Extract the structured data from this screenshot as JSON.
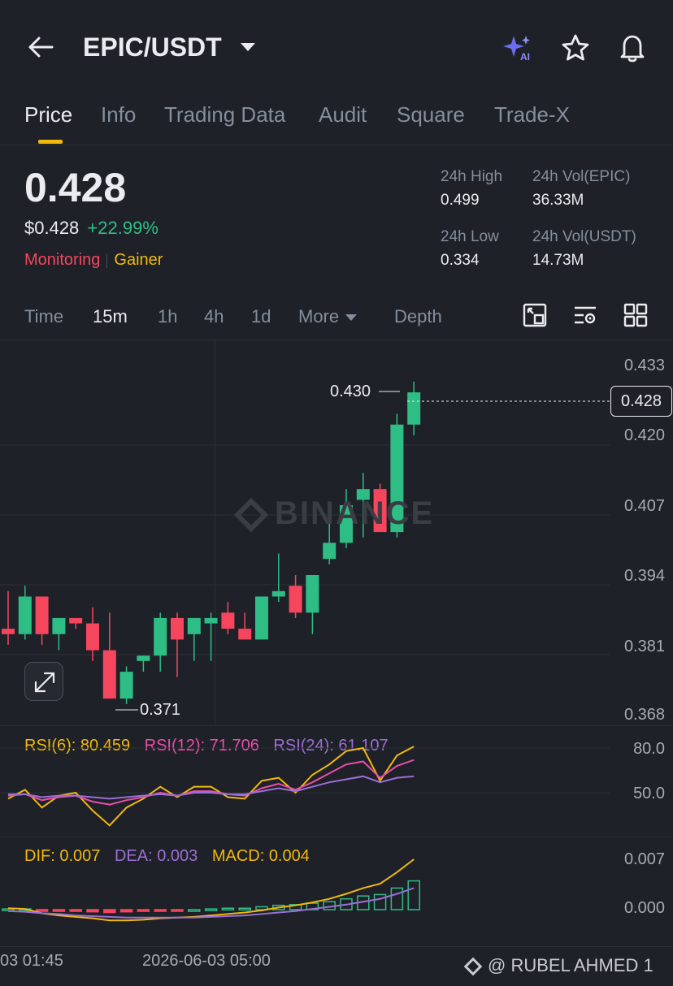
{
  "header": {
    "pair": "EPIC/USDT"
  },
  "tabs": [
    "Price",
    "Info",
    "Trading Data",
    "Audit",
    "Square",
    "Trade-X"
  ],
  "price": {
    "last": "0.428",
    "usd": "$0.428",
    "change": "+22.99%",
    "tag_monitoring": "Monitoring",
    "tag_gainer": "Gainer"
  },
  "stats": {
    "high_label": "24h High",
    "high_value": "0.499",
    "vol_base_label": "24h Vol(EPIC)",
    "vol_base_value": "36.33M",
    "low_label": "24h Low",
    "low_value": "0.334",
    "vol_quote_label": "24h Vol(USDT)",
    "vol_quote_value": "14.73M"
  },
  "toolbar": {
    "time": "Time",
    "m15": "15m",
    "h1": "1h",
    "h4": "4h",
    "d1": "1d",
    "more": "More",
    "depth": "Depth"
  },
  "chart": {
    "y_ticks": [
      "0.433",
      "0.420",
      "0.407",
      "0.394",
      "0.381",
      "0.368"
    ],
    "current_price": "0.428",
    "high_marker": "0.430",
    "low_marker": "0.371",
    "watermark": "BINANCE"
  },
  "rsi": {
    "rsi6": "RSI(6): 80.459",
    "rsi12": "RSI(12): 71.706",
    "rsi24": "RSI(24): 61.107",
    "y_ticks": [
      "80.0",
      "50.0"
    ]
  },
  "macd": {
    "dif": "DIF: 0.007",
    "dea": "DEA: 0.003",
    "macd": "MACD: 0.004",
    "y_ticks": [
      "0.007",
      "0.000"
    ]
  },
  "x_axis": {
    "label1": "03 01:45",
    "label2": "2026-06-03 05:00"
  },
  "credit": "@ RUBEL AHMED 1",
  "colors": {
    "up": "#2ebd85",
    "down": "#f6465d",
    "accent": "#f0b90b",
    "rsi6": "#f0b90b",
    "rsi12": "#e84fa8",
    "rsi24": "#9b6fd6"
  },
  "chart_data": {
    "type": "candlestick",
    "interval": "15m",
    "ylim": [
      0.368,
      0.433
    ],
    "candles": [
      {
        "o": 0.384,
        "h": 0.391,
        "l": 0.381,
        "c": 0.383
      },
      {
        "o": 0.383,
        "h": 0.392,
        "l": 0.382,
        "c": 0.39
      },
      {
        "o": 0.39,
        "h": 0.39,
        "l": 0.381,
        "c": 0.383
      },
      {
        "o": 0.383,
        "h": 0.386,
        "l": 0.38,
        "c": 0.386
      },
      {
        "o": 0.386,
        "h": 0.386,
        "l": 0.384,
        "c": 0.385
      },
      {
        "o": 0.385,
        "h": 0.388,
        "l": 0.378,
        "c": 0.38
      },
      {
        "o": 0.38,
        "h": 0.387,
        "l": 0.371,
        "c": 0.371
      },
      {
        "o": 0.371,
        "h": 0.377,
        "l": 0.37,
        "c": 0.376
      },
      {
        "o": 0.378,
        "h": 0.379,
        "l": 0.376,
        "c": 0.379
      },
      {
        "o": 0.379,
        "h": 0.387,
        "l": 0.376,
        "c": 0.386
      },
      {
        "o": 0.386,
        "h": 0.387,
        "l": 0.375,
        "c": 0.382
      },
      {
        "o": 0.383,
        "h": 0.386,
        "l": 0.378,
        "c": 0.386
      },
      {
        "o": 0.385,
        "h": 0.387,
        "l": 0.378,
        "c": 0.386
      },
      {
        "o": 0.387,
        "h": 0.389,
        "l": 0.383,
        "c": 0.384
      },
      {
        "o": 0.384,
        "h": 0.387,
        "l": 0.382,
        "c": 0.382
      },
      {
        "o": 0.382,
        "h": 0.39,
        "l": 0.382,
        "c": 0.39
      },
      {
        "o": 0.39,
        "h": 0.398,
        "l": 0.389,
        "c": 0.391
      },
      {
        "o": 0.392,
        "h": 0.394,
        "l": 0.386,
        "c": 0.387
      },
      {
        "o": 0.387,
        "h": 0.394,
        "l": 0.383,
        "c": 0.394
      },
      {
        "o": 0.397,
        "h": 0.404,
        "l": 0.396,
        "c": 0.4
      },
      {
        "o": 0.4,
        "h": 0.41,
        "l": 0.399,
        "c": 0.407
      },
      {
        "o": 0.408,
        "h": 0.413,
        "l": 0.401,
        "c": 0.41
      },
      {
        "o": 0.41,
        "h": 0.411,
        "l": 0.402,
        "c": 0.402
      },
      {
        "o": 0.402,
        "h": 0.424,
        "l": 0.401,
        "c": 0.422
      },
      {
        "o": 0.422,
        "h": 0.43,
        "l": 0.42,
        "c": 0.428
      }
    ],
    "rsi6": [
      46,
      52,
      40,
      48,
      50,
      38,
      28,
      40,
      46,
      54,
      47,
      54,
      54,
      47,
      46,
      58,
      60,
      50,
      62,
      69,
      78,
      80,
      58,
      75,
      81
    ],
    "rsi12": [
      48,
      49,
      45,
      47,
      48,
      44,
      42,
      45,
      47,
      50,
      48,
      51,
      51,
      49,
      48,
      53,
      56,
      52,
      57,
      63,
      69,
      71,
      60,
      68,
      72
    ],
    "rsi24": [
      49,
      49,
      47,
      48,
      48,
      47,
      46,
      47,
      48,
      49,
      48,
      50,
      50,
      49,
      49,
      51,
      53,
      51,
      54,
      57,
      59,
      61,
      57,
      60,
      61
    ],
    "dif": [
      0.0002,
      0.0001,
      -0.0005,
      -0.0008,
      -0.001,
      -0.0012,
      -0.0015,
      -0.0015,
      -0.0014,
      -0.0012,
      -0.0011,
      -0.001,
      -0.0008,
      -0.0006,
      -0.0004,
      -0.0001,
      0.0003,
      0.0006,
      0.001,
      0.0015,
      0.0022,
      0.003,
      0.0036,
      0.0052,
      0.007
    ],
    "dea": [
      -0.0002,
      -0.0003,
      -0.0005,
      -0.0006,
      -0.0008,
      -0.0009,
      -0.001,
      -0.0011,
      -0.0011,
      -0.0011,
      -0.0011,
      -0.0011,
      -0.001,
      -0.0009,
      -0.0008,
      -0.0006,
      -0.0004,
      -0.0002,
      0.0001,
      0.0004,
      0.0007,
      0.0011,
      0.0015,
      0.0022,
      0.003
    ],
    "macd_hist": [
      0.0001,
      0.0001,
      -0.0001,
      -0.0002,
      -0.0002,
      -0.0003,
      -0.0004,
      -0.0003,
      -0.0002,
      -0.0001,
      -0.0001,
      0.0,
      0.0001,
      0.0002,
      0.0002,
      0.0004,
      0.0006,
      0.0007,
      0.0009,
      0.0011,
      0.0015,
      0.0019,
      0.0021,
      0.003,
      0.004
    ]
  }
}
